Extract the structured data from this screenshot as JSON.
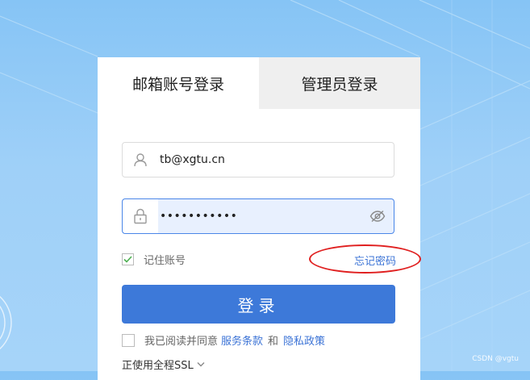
{
  "tabs": [
    {
      "label": "邮箱账号登录",
      "active": true
    },
    {
      "label": "管理员登录",
      "active": false
    }
  ],
  "email_field": {
    "value": "tb@xgtu.cn",
    "icon": "user-icon"
  },
  "password_field": {
    "value": "•••••••••••",
    "icon": "lock-icon",
    "toggle_icon": "eye-slash-icon"
  },
  "remember": {
    "label": "记住账号",
    "checked": true
  },
  "forgot_link": "忘记密码",
  "login_button": "登录",
  "agreement": {
    "prefix": "我已阅读并同意",
    "terms_link": "服务条款",
    "conjunction": "和",
    "privacy_link": "隐私政策",
    "checked": false
  },
  "ssl": {
    "label": "正使用全程SSL",
    "icon": "chevron-down-icon"
  },
  "watermark": "CSDN @vgtu",
  "colors": {
    "accent": "#3d79d9",
    "link": "#3b73d6",
    "annotation": "#e02020",
    "background": "#9fd0f8"
  }
}
